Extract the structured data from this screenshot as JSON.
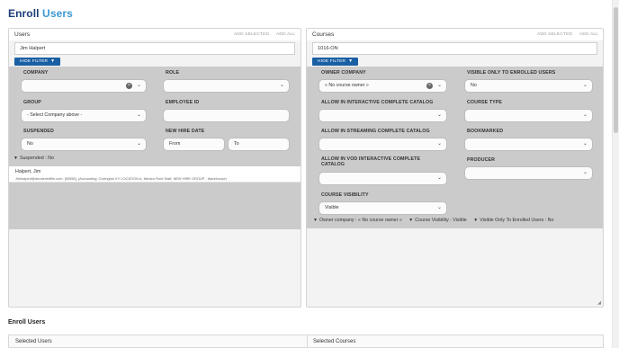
{
  "page": {
    "title_part1": "Enroll",
    "title_part2": "Users"
  },
  "users": {
    "panel_title": "Users",
    "add_selected": "ADD SELECTED",
    "add_all": "ADD ALL",
    "search_value": "Jim Halpert",
    "hide_filter": "HIDE FILTER",
    "labels": {
      "company": "COMPANY",
      "role": "ROLE",
      "group": "GROUP",
      "employee_id": "EMPLOYEE ID",
      "suspended": "SUSPENDED",
      "new_hire_date": "NEW HIRE DATE"
    },
    "group_value": "- Select Company above -",
    "suspended_value": "No",
    "from_placeholder": "From",
    "to_placeholder": "To",
    "filter_summary": "Suspended :  No",
    "results": [
      {
        "name": "Halpert, Jim",
        "detail": "Jimhalpert@dundermifflin.com, [50556], (Accounting, Covington KY LOCATION A, Mexico Field Staff, NEW HIRE GROUP - Warehouse)"
      }
    ]
  },
  "courses": {
    "panel_title": "Courses",
    "add_selected": "ADD SELECTED",
    "add_all": "ADD ALL",
    "search_value": "1016-ON",
    "hide_filter": "HIDE FILTER",
    "labels": {
      "owner_company": "OWNER COMPANY",
      "visible_only": "VISIBLE ONLY TO ENROLLED USERS",
      "allow_interactive": "ALLOW IN INTERACTIVE COMPLETE CATALOG",
      "course_type": "COURSE TYPE",
      "allow_streaming": "ALLOW IN STREAMING COMPLETE CATALOG",
      "bookmarked": "BOOKMARKED",
      "allow_vod": "ALLOW IN VOD INTERACTIVE COMPLETE CATALOG",
      "producer": "PRODUCER",
      "course_visibility": "COURSE VISIBILITY"
    },
    "owner_company_value": "« No course owner »",
    "visible_only_value": "No",
    "course_visibility_value": "Visible",
    "summary": {
      "owner": "Owner company :  « No course owner »",
      "visibility": "Course Visibility :  Visible",
      "visible_only": "Visible Only To Enrolled Users :  No"
    }
  },
  "bottom": {
    "section_title": "Enroll Users",
    "selected_users": "Selected Users",
    "selected_courses": "Selected Courses"
  },
  "colors": {
    "title_dark": "#1c3d7a",
    "title_accent": "#3a98d4",
    "filter_button": "#1a5fa3",
    "filter_bg": "#cbcbcb"
  }
}
